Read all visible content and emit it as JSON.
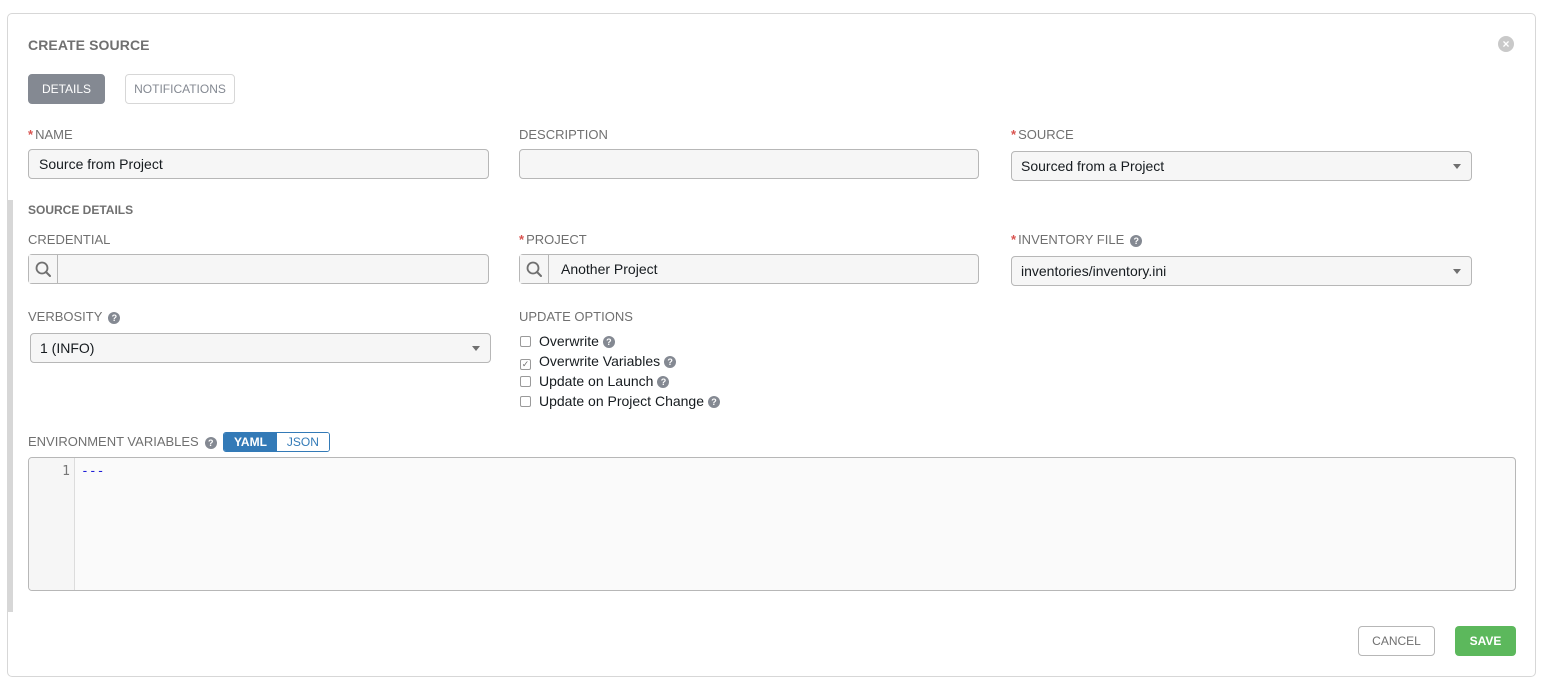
{
  "dialog": {
    "title": "CREATE SOURCE",
    "close_icon": "close-icon"
  },
  "tabs": [
    {
      "label": "DETAILS",
      "active": true
    },
    {
      "label": "NOTIFICATIONS",
      "active": false
    }
  ],
  "fields": {
    "name": {
      "label": "NAME",
      "required": true,
      "value": "Source from Project"
    },
    "description": {
      "label": "DESCRIPTION",
      "required": false,
      "value": ""
    },
    "source": {
      "label": "SOURCE",
      "required": true,
      "value": "Sourced from a Project"
    }
  },
  "source_details": {
    "section_label": "SOURCE DETAILS",
    "credential": {
      "label": "CREDENTIAL",
      "value": ""
    },
    "project": {
      "label": "PROJECT",
      "required": true,
      "value": "Another Project"
    },
    "inventory_file": {
      "label": "INVENTORY FILE",
      "required": true,
      "value": "inventories/inventory.ini"
    },
    "verbosity": {
      "label": "VERBOSITY",
      "value": "1 (INFO)"
    },
    "update_options": {
      "label": "UPDATE OPTIONS",
      "options": [
        {
          "label": "Overwrite",
          "checked": false
        },
        {
          "label": "Overwrite Variables",
          "checked": true
        },
        {
          "label": "Update on Launch",
          "checked": false
        },
        {
          "label": "Update on Project Change",
          "checked": false
        }
      ]
    },
    "environment_variables": {
      "label": "ENVIRONMENT VARIABLES",
      "formats": [
        "YAML",
        "JSON"
      ],
      "selected_format": "YAML",
      "line_number": "1",
      "code": "---"
    }
  },
  "actions": {
    "cancel_label": "CANCEL",
    "save_label": "SAVE"
  },
  "colors": {
    "save": "#5cb85c",
    "active_tab": "#848992",
    "required": "#d9534f",
    "toggle": "#337ab7"
  }
}
